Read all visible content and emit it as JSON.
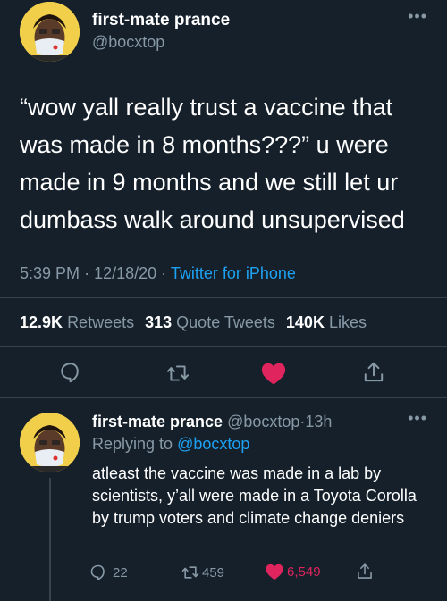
{
  "tweet": {
    "display_name": "first-mate prance",
    "handle": "@bocxtop",
    "more_icon": "more-horizontal-icon",
    "text": "“wow yall really trust a vaccine that was made in 8 months???” u were made in 9 months and we still let ur dumbass walk around unsupervised",
    "time": "5:39 PM",
    "separator": "·",
    "date": "12/18/20",
    "source": "Twitter for iPhone",
    "stats": {
      "retweets_count": "12.9K",
      "retweets_label": "Retweets",
      "quotes_count": "313",
      "quotes_label": "Quote Tweets",
      "likes_count": "140K",
      "likes_label": "Likes"
    },
    "actions": {
      "reply_icon": "reply-icon",
      "retweet_icon": "retweet-icon",
      "like_icon": "heart-icon",
      "share_icon": "share-icon"
    }
  },
  "reply": {
    "display_name": "first-mate prance",
    "handle": "@bocxtop",
    "separator": "·",
    "time_ago": "13h",
    "replying_label": "Replying to",
    "replying_to": "@bocxtop",
    "text": "atleast the vaccine was made in a lab by scientists, y’all were made in a Toyota Corolla by trump voters and climate change deniers",
    "reply_count": "22",
    "retweet_count": "459",
    "like_count": "6,549"
  },
  "colors": {
    "background": "#15202b",
    "secondary_text": "#8899a6",
    "link": "#1da1f2",
    "like_red": "#e0245e",
    "divider": "#38444d"
  }
}
